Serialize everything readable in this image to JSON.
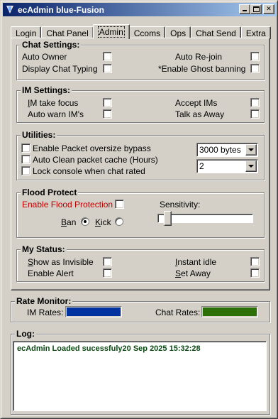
{
  "window": {
    "title": "ecAdmin blue-Fusion"
  },
  "tabs": [
    {
      "label": "Login"
    },
    {
      "label": "Chat Panel"
    },
    {
      "label": "Admin",
      "active": true
    },
    {
      "label": "Ccoms"
    },
    {
      "label": "Ops"
    },
    {
      "label": "Chat Send"
    },
    {
      "label": "Extra"
    }
  ],
  "chat_settings": {
    "title": "Chat Settings:",
    "auto_owner": "Auto Owner",
    "display_chat_typing": "Display Chat Typing",
    "auto_rejoin": "Auto Re-join",
    "enable_ghost_banning": "*Enable Ghost banning"
  },
  "im_settings": {
    "title": "IM Settings:",
    "im_take_focus": "IM take focus",
    "auto_warn_ims": "Auto warn IM's",
    "accept_ims": "Accept IMs",
    "talk_as_away": "Talk as Away"
  },
  "utilities": {
    "title": "Utilities:",
    "packet_oversize": "Enable Packet oversize bypass",
    "auto_clean": "Auto Clean packet cache (Hours)",
    "lock_console": "Lock console when chat rated",
    "bytes_select": "3000 bytes",
    "hours_select": "2"
  },
  "flood_protect": {
    "title": "Flood Protect",
    "enable_label": "Enable Flood Protection",
    "sensitivity_label": "Sensitivity:",
    "ban_label": "Ban",
    "kick_label": "Kick",
    "selected_action": "Ban"
  },
  "my_status": {
    "title": "My Status:",
    "show_invisible": "Show as Invisible",
    "enable_alert": "Enable Alert",
    "instant_idle": "Instant idle",
    "set_away": "Set Away"
  },
  "rate_monitor": {
    "title": "Rate Monitor:",
    "im_label": "IM Rates:",
    "chat_label": "Chat Rates:",
    "im_color": "#0033a0",
    "chat_color": "#2e7008"
  },
  "log": {
    "title": "Log:",
    "entry": "ecAdmin  Loaded sucessfuly20 Sep 2025 15:32:28"
  },
  "colors": {
    "title_bar_start": "#0a246a",
    "title_bar_end": "#a6caf0",
    "flood_label": "#c00000",
    "log_text": "#0a4a12"
  }
}
